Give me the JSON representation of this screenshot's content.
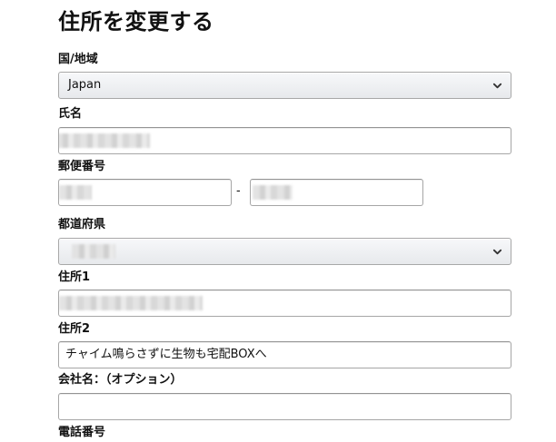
{
  "page": {
    "title": "住所を変更する"
  },
  "form": {
    "country": {
      "label": "国/地域",
      "value": "Japan"
    },
    "name": {
      "label": "氏名",
      "value": ""
    },
    "postal_code": {
      "label": "郵便番号",
      "part1": "",
      "separator": "-",
      "part2": ""
    },
    "prefecture": {
      "label": "都道府県",
      "value": ""
    },
    "address1": {
      "label": "住所1",
      "value": ""
    },
    "address2": {
      "label": "住所2",
      "value": "チャイム鳴らさずに生物も宅配BOXへ"
    },
    "company": {
      "label": "会社名：（オプション）",
      "value": ""
    },
    "phone": {
      "label": "電話番号"
    }
  },
  "icons": {
    "dropdown": "chevron-down-icon"
  }
}
